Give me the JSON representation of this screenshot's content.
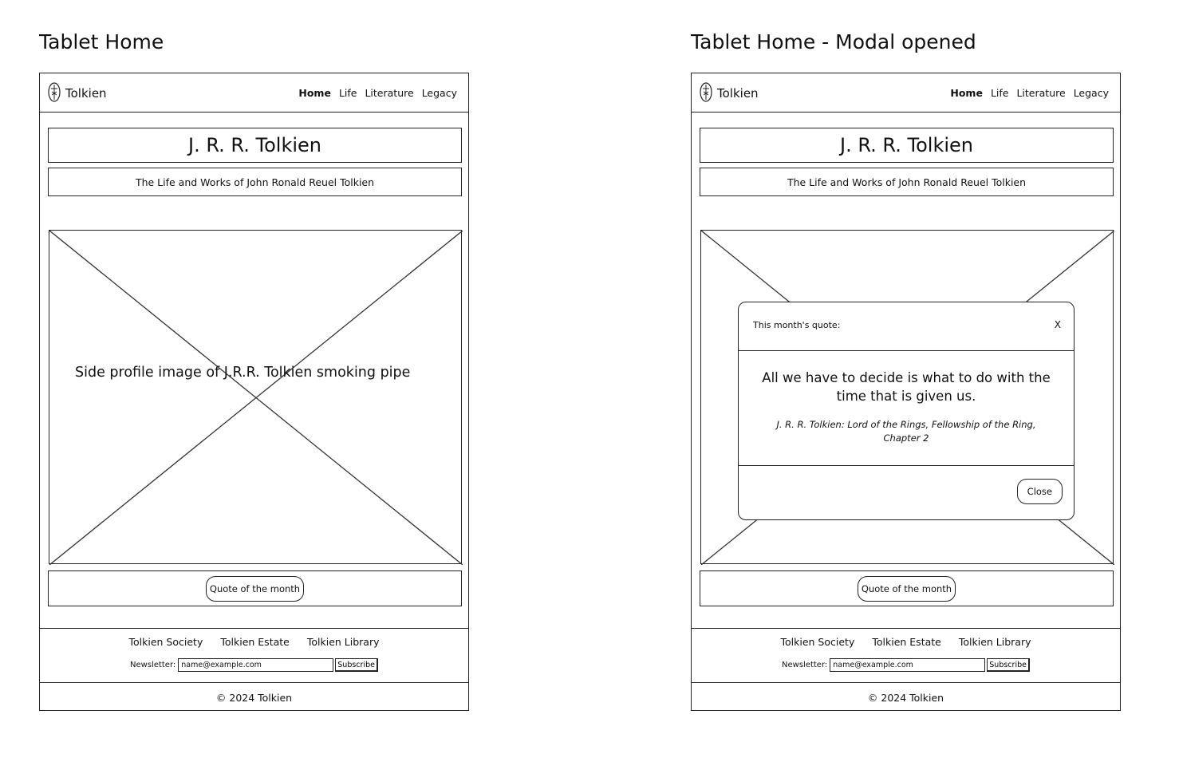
{
  "left": {
    "frame_title": "Tablet Home",
    "brand": "Tolkien",
    "nav": [
      "Home",
      "Life",
      "Literature",
      "Legacy"
    ],
    "title": "J. R. R. Tolkien",
    "subtitle": "The Life and Works of John Ronald Reuel Tolkien",
    "image_caption": "Side profile image of J.R.R. Tolkien smoking pipe",
    "quote_button": "Quote of the month",
    "footer_links": [
      "Tolkien Society",
      "Tolkien Estate",
      "Tolkien Library"
    ],
    "newsletter_label": "Newsletter:",
    "newsletter_placeholder": "name@example.com",
    "subscribe": "Subscribe",
    "copyright": "© 2024 Tolkien"
  },
  "right": {
    "frame_title": "Tablet Home - Modal opened",
    "brand": "Tolkien",
    "nav": [
      "Home",
      "Life",
      "Literature",
      "Legacy"
    ],
    "title": "J. R. R. Tolkien",
    "subtitle": "The Life and Works of John Ronald Reuel Tolkien",
    "quote_button": "Quote of the month",
    "footer_links": [
      "Tolkien Society",
      "Tolkien Estate",
      "Tolkien Library"
    ],
    "newsletter_label": "Newsletter:",
    "newsletter_placeholder": "name@example.com",
    "subscribe": "Subscribe",
    "copyright": "© 2024 Tolkien",
    "modal": {
      "title": "This month's quote:",
      "close_x": "X",
      "quote": "All we have to decide is what to do with the time that is given us.",
      "source": "J. R. R. Tolkien: Lord of the Rings, Fellowship of the Ring, Chapter 2",
      "close_button": "Close"
    }
  }
}
